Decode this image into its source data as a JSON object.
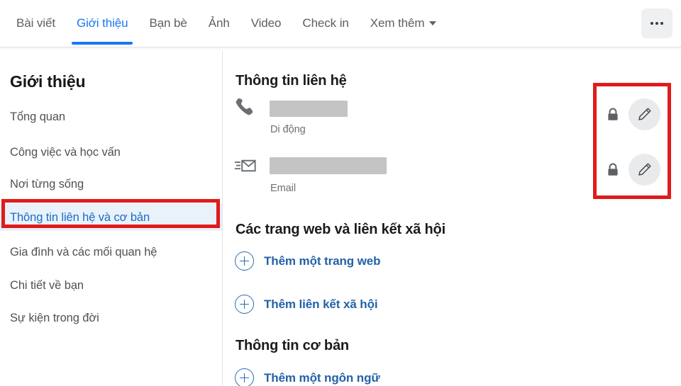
{
  "tabbar": {
    "tabs": [
      {
        "label": "Bài viết",
        "name": "tab-posts",
        "active": false
      },
      {
        "label": "Giới thiệu",
        "name": "tab-about",
        "active": true
      },
      {
        "label": "Bạn bè",
        "name": "tab-friends",
        "active": false
      },
      {
        "label": "Ảnh",
        "name": "tab-photos",
        "active": false
      },
      {
        "label": "Video",
        "name": "tab-videos",
        "active": false
      },
      {
        "label": "Check in",
        "name": "tab-checkin",
        "active": false
      },
      {
        "label": "Xem thêm",
        "name": "tab-more",
        "active": false,
        "caret": true
      }
    ],
    "more_button_icon": "ellipsis-horizontal-icon"
  },
  "sidebar": {
    "title": "Giới thiệu",
    "items": [
      {
        "label": "Tổng quan",
        "name": "sidebar-item-overview",
        "active": false
      },
      {
        "label": "Công việc và học vấn",
        "name": "sidebar-item-work-education",
        "active": false
      },
      {
        "label": "Nơi từng sống",
        "name": "sidebar-item-places-lived",
        "active": false
      },
      {
        "label": "Thông tin liên hệ và cơ bản",
        "name": "sidebar-item-contact-basic-info",
        "active": true
      },
      {
        "label": "Gia đình và các mối quan hệ",
        "name": "sidebar-item-family-relationships",
        "active": false
      },
      {
        "label": "Chi tiết về bạn",
        "name": "sidebar-item-details-about-you",
        "active": false
      },
      {
        "label": "Sự kiện trong đời",
        "name": "sidebar-item-life-events",
        "active": false
      }
    ]
  },
  "main": {
    "contact_section": {
      "title": "Thông tin liên hệ",
      "rows": [
        {
          "icon": "phone-icon",
          "value": "",
          "value_redacted": true,
          "sublabel": "Di động",
          "privacy_icon": "lock-icon",
          "edit_icon": "pencil-icon"
        },
        {
          "icon": "envelope-icon",
          "value": "",
          "value_redacted": true,
          "sublabel": "Email",
          "privacy_icon": "lock-icon",
          "edit_icon": "pencil-icon"
        }
      ]
    },
    "websites_section": {
      "title": "Các trang web và liên kết xã hội",
      "actions": [
        {
          "label": "Thêm một trang web",
          "name": "add-website-button",
          "icon": "plus-circle-icon"
        },
        {
          "label": "Thêm liên kết xã hội",
          "name": "add-social-link-button",
          "icon": "plus-circle-icon"
        }
      ]
    },
    "basic_section": {
      "title": "Thông tin cơ bản",
      "actions": [
        {
          "label": "Thêm một ngôn ngữ",
          "name": "add-language-button",
          "icon": "plus-circle-icon"
        }
      ]
    }
  },
  "annotations": [
    {
      "name": "annotation-box-sidebar-contact-info",
      "color": "#e01b1b"
    },
    {
      "name": "annotation-box-edit-controls",
      "color": "#e01b1b"
    }
  ],
  "colors": {
    "accent_blue": "#1877f2",
    "link_blue": "#2361a8",
    "active_bg": "#e9f2fb",
    "annotation_red": "#e01b1b",
    "redacted_gray": "#c4c4c4"
  }
}
